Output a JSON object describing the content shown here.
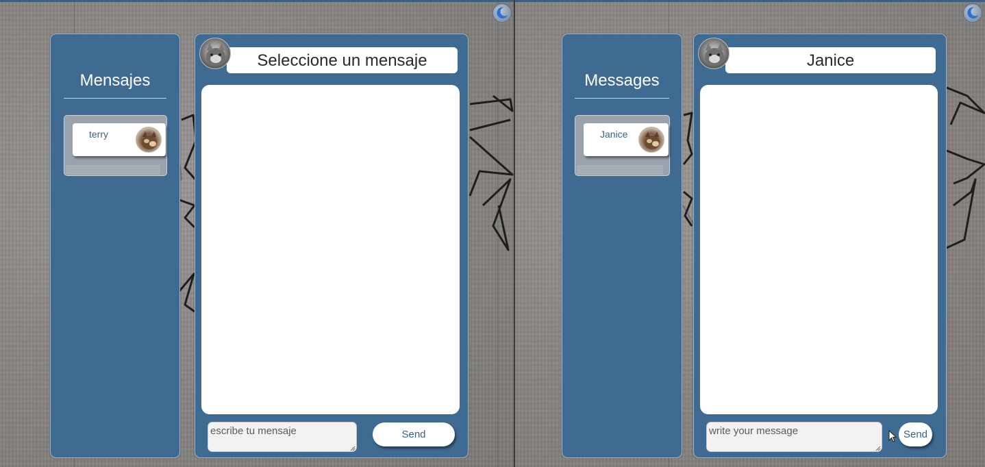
{
  "colors": {
    "panel_blue": "#3f6a92",
    "panel_border": "#9fb4c8",
    "accent_text": "#3b5f83",
    "background_concrete": "#8c8a87",
    "divider": "#3c3a38"
  },
  "theme_toggle": {
    "icon": "moon-icon"
  },
  "left_view": {
    "language": "es",
    "sidebar": {
      "title": "Mensajes",
      "conversations": [
        {
          "name": "terry",
          "avatar": "cat-avatar"
        }
      ]
    },
    "chat": {
      "avatar": "cat-avatar-gray",
      "header": "Seleccione un mensaje",
      "input_placeholder": "escribe tu mensaje",
      "input_value": "",
      "send_label": "Send"
    }
  },
  "right_view": {
    "language": "en",
    "sidebar": {
      "title": "Messages",
      "conversations": [
        {
          "name": "Janice",
          "avatar": "cat-avatar"
        }
      ]
    },
    "chat": {
      "avatar": "cat-avatar-gray",
      "header": "Janice",
      "input_placeholder": "write your message",
      "input_value": "",
      "send_label": "Send"
    }
  }
}
